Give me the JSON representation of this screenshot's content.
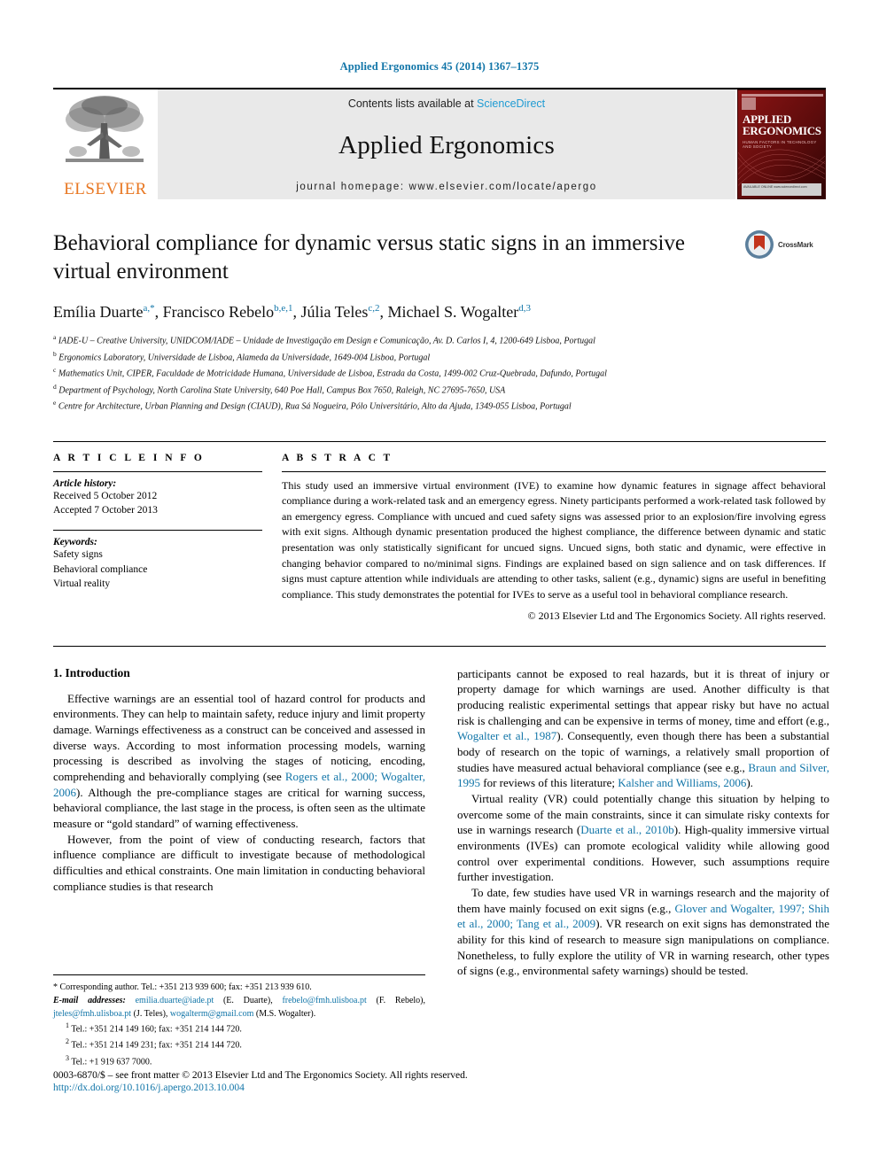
{
  "running_head": "Applied Ergonomics 45 (2014) 1367–1375",
  "masthead": {
    "publisher_name": "ELSEVIER",
    "contents_prefix": "Contents lists available at ",
    "contents_link": "ScienceDirect",
    "journal_title": "Applied Ergonomics",
    "homepage": "journal homepage: www.elsevier.com/locate/apergo",
    "cover": {
      "title_line1": "APPLIED",
      "title_line2": "ERGONOMICS",
      "subtitle": "HUMAN FACTORS IN TECHNOLOGY AND SOCIETY",
      "footer_text": "AVAILABLE ONLINE\nwww.sciencedirect.com"
    }
  },
  "article": {
    "title": "Behavioral compliance for dynamic versus static signs in an immersive virtual environment",
    "crossmark_label": "CrossMark",
    "authors": [
      {
        "name": "Emília Duarte",
        "marks": "a,*"
      },
      {
        "name": "Francisco Rebelo",
        "marks": "b,e,1"
      },
      {
        "name": "Júlia Teles",
        "marks": "c,2"
      },
      {
        "name": "Michael S. Wogalter",
        "marks": "d,3"
      }
    ],
    "affiliations": [
      {
        "mark": "a",
        "text": "IADE-U – Creative University, UNIDCOM/IADE – Unidade de Investigação em Design e Comunicação, Av. D. Carlos I, 4, 1200-649 Lisboa, Portugal"
      },
      {
        "mark": "b",
        "text": "Ergonomics Laboratory, Universidade de Lisboa, Alameda da Universidade, 1649-004 Lisboa, Portugal"
      },
      {
        "mark": "c",
        "text": "Mathematics Unit, CIPER, Faculdade de Motricidade Humana, Universidade de Lisboa, Estrada da Costa, 1499-002 Cruz-Quebrada, Dafundo, Portugal"
      },
      {
        "mark": "d",
        "text": "Department of Psychology, North Carolina State University, 640 Poe Hall, Campus Box 7650, Raleigh, NC 27695-7650, USA"
      },
      {
        "mark": "e",
        "text": "Centre for Architecture, Urban Planning and Design (CIAUD), Rua Sá Nogueira, Pólo Universitário, Alto da Ajuda, 1349-055 Lisboa, Portugal"
      }
    ]
  },
  "article_info": {
    "heading": "A R T I C L E  I N F O",
    "history_label": "Article history:",
    "history": [
      "Received 5 October 2012",
      "Accepted 7 October 2013"
    ],
    "keywords_label": "Keywords:",
    "keywords": [
      "Safety signs",
      "Behavioral compliance",
      "Virtual reality"
    ]
  },
  "abstract": {
    "heading": "A B S T R A C T",
    "text": "This study used an immersive virtual environment (IVE) to examine how dynamic features in signage affect behavioral compliance during a work-related task and an emergency egress. Ninety participants performed a work-related task followed by an emergency egress. Compliance with uncued and cued safety signs was assessed prior to an explosion/fire involving egress with exit signs. Although dynamic presentation produced the highest compliance, the difference between dynamic and static presentation was only statistically significant for uncued signs. Uncued signs, both static and dynamic, were effective in changing behavior compared to no/minimal signs. Findings are explained based on sign salience and on task differences. If signs must capture attention while individuals are attending to other tasks, salient (e.g., dynamic) signs are useful in benefiting compliance. This study demonstrates the potential for IVEs to serve as a useful tool in behavioral compliance research.",
    "copyright": "© 2013 Elsevier Ltd and The Ergonomics Society. All rights reserved."
  },
  "body": {
    "section_title": "1. Introduction",
    "left_paragraphs": [
      "Effective warnings are an essential tool of hazard control for products and environments. They can help to maintain safety, reduce injury and limit property damage. Warnings effectiveness as a construct can be conceived and assessed in diverse ways. According to most information processing models, warning processing is described as involving the stages of noticing, encoding, comprehending and behaviorally complying (see @@Rogers et al., 2000; Wogalter, 2006@@). Although the pre-compliance stages are critical for warning success, behavioral compliance, the last stage in the process, is often seen as the ultimate measure or “gold standard” of warning effectiveness.",
      "However, from the point of view of conducting research, factors that influence compliance are difficult to investigate because of methodological difficulties and ethical constraints. One main limitation in conducting behavioral compliance studies is that research"
    ],
    "right_paragraphs": [
      "participants cannot be exposed to real hazards, but it is threat of injury or property damage for which warnings are used. Another difficulty is that producing realistic experimental settings that appear risky but have no actual risk is challenging and can be expensive in terms of money, time and effort (e.g., @@Wogalter et al., 1987@@). Consequently, even though there has been a substantial body of research on the topic of warnings, a relatively small proportion of studies have measured actual behavioral compliance (see e.g., @@Braun and Silver, 1995@@ for reviews of this literature; @@Kalsher and Williams, 2006@@).",
      "Virtual reality (VR) could potentially change this situation by helping to overcome some of the main constraints, since it can simulate risky contexts for use in warnings research (@@Duarte et al., 2010b@@). High-quality immersive virtual environments (IVEs) can promote ecological validity while allowing good control over experimental conditions. However, such assumptions require further investigation.",
      "To date, few studies have used VR in warnings research and the majority of them have mainly focused on exit signs (e.g., @@Glover and Wogalter, 1997; Shih et al., 2000; Tang et al., 2009@@). VR research on exit signs has demonstrated the ability for this kind of research to measure sign manipulations on compliance. Nonetheless, to fully explore the utility of VR in warning research, other types of signs (e.g., environmental safety warnings) should be tested."
    ]
  },
  "footnotes": {
    "corresponding": "* Corresponding author. Tel.: +351 213 939 600; fax: +351 213 939 610.",
    "emails_label": "E-mail addresses:",
    "emails": [
      {
        "address": "emilia.duarte@iade.pt",
        "owner": "(E. Duarte)"
      },
      {
        "address": "frebelo@fmh.ulisboa.pt",
        "owner": "(F. Rebelo)"
      },
      {
        "address": "jteles@fmh.ulisboa.pt",
        "owner": "(J. Teles)"
      },
      {
        "address": "wogalterm@gmail.com",
        "owner": "(M.S. Wogalter)"
      }
    ],
    "numbered": [
      {
        "num": "1",
        "text": "Tel.: +351 214 149 160; fax: +351 214 144 720."
      },
      {
        "num": "2",
        "text": "Tel.: +351 214 149 231; fax: +351 214 144 720."
      },
      {
        "num": "3",
        "text": "Tel.: +1 919 637 7000."
      }
    ]
  },
  "page_footer": {
    "issn_line": "0003-6870/$ – see front matter © 2013 Elsevier Ltd and The Ergonomics Society. All rights reserved.",
    "doi": "http://dx.doi.org/10.1016/j.apergo.2013.10.004"
  },
  "colors": {
    "link": "#1175a8",
    "sciencedirect": "#1f9bd3",
    "elsevier_orange": "#e87722",
    "cover_red": "#6d0f0f"
  }
}
